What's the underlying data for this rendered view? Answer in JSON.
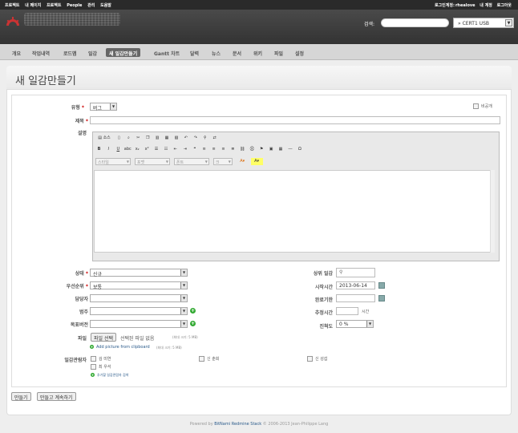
{
  "top_menu": {
    "left": [
      "프로젝트",
      "내 페이지",
      "프로젝트",
      "People",
      "관리",
      "도움말"
    ],
    "login_prefix": "로그인계정:",
    "user": "rhealove",
    "my_account": "내 계정",
    "logout": "로그아웃"
  },
  "header": {
    "search_label": "검색:",
    "search_value": "",
    "project_select": "» CERT1 USB"
  },
  "main_menu": [
    "개요",
    "작업내역",
    "로드맵",
    "일감",
    "새 일감만들기",
    "Gantt 차트",
    "달력",
    "뉴스",
    "문서",
    "위키",
    "파일",
    "설정"
  ],
  "page_title": "새 일감만들기",
  "form": {
    "tracker_label": "유형",
    "tracker_value": "버그",
    "private_label": "비공개",
    "subject_label": "제목",
    "subject_value": "",
    "description_label": "설명",
    "toolbar_row1": [
      "소스",
      "",
      "",
      "",
      "",
      "",
      "",
      "",
      "",
      "",
      ""
    ],
    "toolbar_row3_selects": [
      "스타일",
      "포맷",
      "폰트",
      "크"
    ],
    "status_label": "상태",
    "status_value": "신규",
    "priority_label": "우선순위",
    "priority_value": "보통",
    "assignee_label": "담당자",
    "assignee_value": "",
    "category_label": "범주",
    "category_value": "",
    "version_label": "목표버전",
    "version_value": "",
    "parent_label": "상위 일감",
    "parent_value": "",
    "start_label": "시작시간",
    "start_value": "2013-06-14",
    "due_label": "완료기한",
    "due_value": "",
    "estimated_label": "추정시간",
    "estimated_value": "",
    "estimated_unit": "시간",
    "done_label": "진척도",
    "done_value": "0 %",
    "files_label": "파일",
    "file_button": "파일 선택",
    "file_status": "선택된 파일 없음",
    "file_max": "(최대 크기: 5 MB)",
    "clipboard_link": "Add picture from clipboard",
    "clipboard_max": "(최대 크기: 5 MB)",
    "watchers_label": "일감관람자",
    "watchers": [
      "김 미연",
      "신 춘희",
      "신 성섭",
      "최 우석"
    ],
    "add_watchers_link": "추가할 일감관람자 검색"
  },
  "buttons": {
    "create": "만들기",
    "create_continue": "만들고 계속하기"
  },
  "footer": {
    "prefix": "Powered by",
    "link": "BitNami Redmine Stack",
    "suffix": "© 2006-2013 Jean-Philippe Lang"
  }
}
